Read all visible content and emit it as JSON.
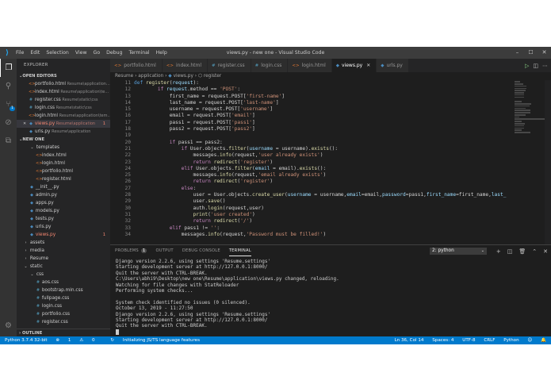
{
  "window": {
    "title": "views.py - new one - Visual Studio Code",
    "menu": [
      "File",
      "Edit",
      "Selection",
      "View",
      "Go",
      "Debug",
      "Terminal",
      "Help"
    ]
  },
  "activity": {
    "scm_badge": "1"
  },
  "explorer": {
    "title": "EXPLORER",
    "open_editors_label": "OPEN EDITORS",
    "open_editors": [
      {
        "name": "portfolio.html",
        "path": "Resume\\application...",
        "type": "html"
      },
      {
        "name": "index.html",
        "path": "Resume\\application\\te...",
        "type": "html"
      },
      {
        "name": "register.css",
        "path": "Resume\\static\\css",
        "type": "css"
      },
      {
        "name": "login.css",
        "path": "Resume\\static\\css",
        "type": "css"
      },
      {
        "name": "login.html",
        "path": "Resume\\application\\tem...",
        "type": "html"
      },
      {
        "name": "views.py",
        "path": "Resume\\application",
        "type": "py",
        "selected": true,
        "error": true,
        "count": "1"
      },
      {
        "name": "urls.py",
        "path": "Resume\\application",
        "type": "py"
      }
    ],
    "project_label": "NEW ONE",
    "tree": [
      {
        "name": "templates",
        "depth": 1,
        "kind": "folder-open"
      },
      {
        "name": "index.html",
        "depth": 2,
        "type": "html"
      },
      {
        "name": "login.html",
        "depth": 2,
        "type": "html"
      },
      {
        "name": "portfolio.html",
        "depth": 2,
        "type": "html"
      },
      {
        "name": "register.html",
        "depth": 2,
        "type": "html"
      },
      {
        "name": "__init__.py",
        "depth": 1,
        "type": "py"
      },
      {
        "name": "admin.py",
        "depth": 1,
        "type": "py"
      },
      {
        "name": "apps.py",
        "depth": 1,
        "type": "py"
      },
      {
        "name": "models.py",
        "depth": 1,
        "type": "py"
      },
      {
        "name": "tests.py",
        "depth": 1,
        "type": "py"
      },
      {
        "name": "urls.py",
        "depth": 1,
        "type": "py"
      },
      {
        "name": "views.py",
        "depth": 1,
        "type": "py",
        "error": true,
        "count": "1"
      },
      {
        "name": "assets",
        "depth": 0,
        "kind": "folder"
      },
      {
        "name": "media",
        "depth": 0,
        "kind": "folder"
      },
      {
        "name": "Resume",
        "depth": 0,
        "kind": "folder"
      },
      {
        "name": "static",
        "depth": 0,
        "kind": "folder-open"
      },
      {
        "name": "css",
        "depth": 1,
        "kind": "folder-open"
      },
      {
        "name": "aos.css",
        "depth": 2,
        "type": "css"
      },
      {
        "name": "bootstrap.min.css",
        "depth": 2,
        "type": "css"
      },
      {
        "name": "fullpage.css",
        "depth": 2,
        "type": "css"
      },
      {
        "name": "login.css",
        "depth": 2,
        "type": "css"
      },
      {
        "name": "portfolio.css",
        "depth": 2,
        "type": "css"
      },
      {
        "name": "register.css",
        "depth": 2,
        "type": "css"
      }
    ],
    "outline_label": "OUTLINE"
  },
  "tabs": [
    {
      "name": "portfolio.html",
      "type": "html"
    },
    {
      "name": "index.html",
      "type": "html"
    },
    {
      "name": "register.css",
      "type": "css"
    },
    {
      "name": "login.css",
      "type": "css"
    },
    {
      "name": "login.html",
      "type": "html"
    },
    {
      "name": "views.py",
      "type": "py",
      "active": true
    },
    {
      "name": "urls.py",
      "type": "py"
    }
  ],
  "breadcrumb": {
    "parts": [
      "Resume",
      "application",
      "views.py",
      "register"
    ],
    "separator": "›"
  },
  "editor": {
    "lines": [
      {
        "n": "11",
        "t": [
          [
            "k",
            "def "
          ],
          [
            "f",
            "register"
          ],
          [
            "",
            "("
          ],
          [
            "p",
            "request"
          ],
          [
            "",
            "):"
          ]
        ]
      },
      {
        "n": "12",
        "t": [
          [
            "",
            "        "
          ],
          [
            "kc",
            "if "
          ],
          [
            "v",
            "request"
          ],
          [
            "",
            ".method == "
          ],
          [
            "s",
            "'POST'"
          ],
          [
            "",
            ":"
          ]
        ]
      },
      {
        "n": "13",
        "t": [
          [
            "",
            "            first_name = request.POST["
          ],
          [
            "s",
            "'first-name'"
          ],
          [
            "",
            "]"
          ]
        ]
      },
      {
        "n": "14",
        "t": [
          [
            "",
            "            last_name = request.POST["
          ],
          [
            "s",
            "'last-name'"
          ],
          [
            "",
            "]"
          ]
        ]
      },
      {
        "n": "15",
        "t": [
          [
            "",
            "            username = request.POST["
          ],
          [
            "s",
            "'username'"
          ],
          [
            "",
            "]"
          ]
        ]
      },
      {
        "n": "16",
        "t": [
          [
            "",
            "            email = request.POST["
          ],
          [
            "s",
            "'email'"
          ],
          [
            "",
            "]"
          ]
        ]
      },
      {
        "n": "17",
        "t": [
          [
            "",
            "            pass1 = request.POST["
          ],
          [
            "s",
            "'pass1'"
          ],
          [
            "",
            "]"
          ]
        ]
      },
      {
        "n": "18",
        "t": [
          [
            "",
            "            pass2 = request.POST["
          ],
          [
            "s",
            "'pass2'"
          ],
          [
            "",
            "]"
          ]
        ]
      },
      {
        "n": "19",
        "t": [
          [
            "",
            ""
          ]
        ]
      },
      {
        "n": "20",
        "t": [
          [
            "",
            "            "
          ],
          [
            "kc",
            "if "
          ],
          [
            "",
            "pass1 == pass2:"
          ]
        ]
      },
      {
        "n": "21",
        "t": [
          [
            "",
            "                "
          ],
          [
            "kc",
            "if "
          ],
          [
            "",
            "User.objects."
          ],
          [
            "f",
            "filter"
          ],
          [
            "",
            "("
          ],
          [
            "p",
            "username"
          ],
          [
            "",
            " = username)."
          ],
          [
            "f",
            "exists"
          ],
          [
            "",
            "():"
          ]
        ]
      },
      {
        "n": "22",
        "t": [
          [
            "",
            "                    messages."
          ],
          [
            "f",
            "info"
          ],
          [
            "",
            "(request,"
          ],
          [
            "s",
            "'user already exists'"
          ],
          [
            "",
            ")"
          ]
        ]
      },
      {
        "n": "23",
        "t": [
          [
            "",
            "                    "
          ],
          [
            "kc",
            "return "
          ],
          [
            "f",
            "redirect"
          ],
          [
            "",
            "("
          ],
          [
            "s",
            "'register'"
          ],
          [
            "",
            ")"
          ]
        ]
      },
      {
        "n": "24",
        "t": [
          [
            "",
            "                "
          ],
          [
            "kc",
            "elif "
          ],
          [
            "",
            "User.objects."
          ],
          [
            "f",
            "filter"
          ],
          [
            "",
            "("
          ],
          [
            "p",
            "email"
          ],
          [
            "",
            " = email)."
          ],
          [
            "f",
            "exists"
          ],
          [
            "",
            "():"
          ]
        ]
      },
      {
        "n": "25",
        "t": [
          [
            "",
            "                    messages."
          ],
          [
            "f",
            "info"
          ],
          [
            "",
            "(request,"
          ],
          [
            "s",
            "'email already exists'"
          ],
          [
            "",
            ")"
          ]
        ]
      },
      {
        "n": "26",
        "t": [
          [
            "",
            "                    "
          ],
          [
            "kc",
            "return "
          ],
          [
            "f",
            "redirect"
          ],
          [
            "",
            "("
          ],
          [
            "s",
            "'register'"
          ],
          [
            "",
            ")"
          ]
        ]
      },
      {
        "n": "27",
        "t": [
          [
            "",
            "                "
          ],
          [
            "kc",
            "else"
          ],
          [
            "",
            ":"
          ]
        ]
      },
      {
        "n": "28",
        "t": [
          [
            "",
            "                    user = User.objects."
          ],
          [
            "f",
            "create_user"
          ],
          [
            "",
            "("
          ],
          [
            "p",
            "username"
          ],
          [
            "",
            " = username,"
          ],
          [
            "p",
            "email"
          ],
          [
            "",
            "=email,"
          ],
          [
            "p",
            "password"
          ],
          [
            "",
            "=pass1,"
          ],
          [
            "p",
            "first_name"
          ],
          [
            "",
            "=first_name,"
          ],
          [
            "p",
            "last_name"
          ],
          [
            "",
            "=last_name)"
          ]
        ]
      },
      {
        "n": "29",
        "t": [
          [
            "",
            "                    user."
          ],
          [
            "f",
            "save"
          ],
          [
            "",
            "()"
          ]
        ]
      },
      {
        "n": "30",
        "t": [
          [
            "",
            "                    auth."
          ],
          [
            "f",
            "login"
          ],
          [
            "",
            "(request,user)"
          ]
        ]
      },
      {
        "n": "31",
        "t": [
          [
            "",
            "                    "
          ],
          [
            "f",
            "print"
          ],
          [
            "",
            "("
          ],
          [
            "s",
            "'user created'"
          ],
          [
            "",
            ")"
          ]
        ]
      },
      {
        "n": "32",
        "t": [
          [
            "",
            "                    "
          ],
          [
            "kc",
            "return "
          ],
          [
            "f",
            "redirect"
          ],
          [
            "",
            "("
          ],
          [
            "s",
            "'/'"
          ],
          [
            "",
            ")"
          ]
        ]
      },
      {
        "n": "33",
        "t": [
          [
            "",
            "            "
          ],
          [
            "kc",
            "elif "
          ],
          [
            "",
            "pass1 != "
          ],
          [
            "s",
            "''"
          ],
          [
            "",
            ":"
          ]
        ]
      },
      {
        "n": "34",
        "t": [
          [
            "",
            "                messages."
          ],
          [
            "f",
            "info"
          ],
          [
            "",
            "(request,"
          ],
          [
            "s",
            "'Password must be filled!'"
          ],
          [
            "",
            ")"
          ]
        ]
      }
    ]
  },
  "panel": {
    "tabs": [
      {
        "label": "PROBLEMS",
        "badge": "1"
      },
      {
        "label": "OUTPUT"
      },
      {
        "label": "DEBUG CONSOLE"
      },
      {
        "label": "TERMINAL",
        "active": true
      }
    ],
    "terminal_select": "2: python",
    "terminal_lines": [
      "Django version 2.2.6, using settings 'Resume.settings'",
      "Starting development server at http://127.0.0.1:8000/",
      "Quit the server with CTRL-BREAK.",
      "C:\\Users\\abhi9\\Desktop\\new one\\Resume\\application\\views.py changed, reloading.",
      "Watching for file changes with StatReloader",
      "Performing system checks...",
      "",
      "System check identified no issues (0 silenced).",
      "October 13, 2019 - 11:27:50",
      "Django version 2.2.6, using settings 'Resume.settings'",
      "Starting development server at http://127.0.0.1:8000/",
      "Quit the server with CTRL-BREAK."
    ]
  },
  "statusbar": {
    "python": "Python 3.7.4 32-bit",
    "errors": "1",
    "warnings": "0",
    "message": "Initializing JS/TS language features",
    "position": "Ln 36, Col 14",
    "spaces": "Spaces: 4",
    "encoding": "UTF-8",
    "eol": "CRLF",
    "language": "Python"
  },
  "colors": {
    "status": "#007acc",
    "editor_bg": "#1e1e1e",
    "sidebar_bg": "#252526",
    "error": "#f48771"
  }
}
